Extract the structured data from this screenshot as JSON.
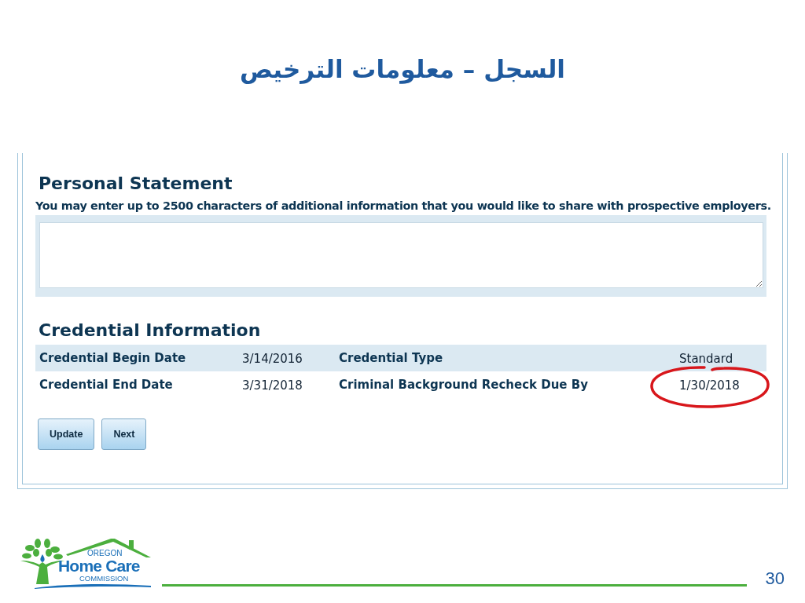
{
  "slide_title": "السجل – معلومات الترخيص",
  "personal_statement": {
    "heading": "Personal Statement",
    "instructions": "You may enter up to 2500 characters of additional information that you would like to share with prospective employers."
  },
  "credential_information": {
    "heading": "Credential Information",
    "rows": [
      {
        "shaded": true,
        "fields": [
          {
            "label": "Credential Begin Date",
            "value": "3/14/2016",
            "circled": false
          },
          {
            "label": "Credential Type",
            "value": "Standard",
            "circled": false
          }
        ]
      },
      {
        "shaded": false,
        "fields": [
          {
            "label": "Credential End Date",
            "value": "3/31/2018",
            "circled": false
          },
          {
            "label": "Criminal Background Recheck Due By",
            "value": "1/30/2018",
            "circled": true
          }
        ]
      }
    ]
  },
  "buttons": [
    "Update",
    "Next"
  ],
  "logo": {
    "line_1": "OREGON",
    "line_2": "Home Care",
    "line_3": "COMMISSION"
  },
  "page_number": "30"
}
